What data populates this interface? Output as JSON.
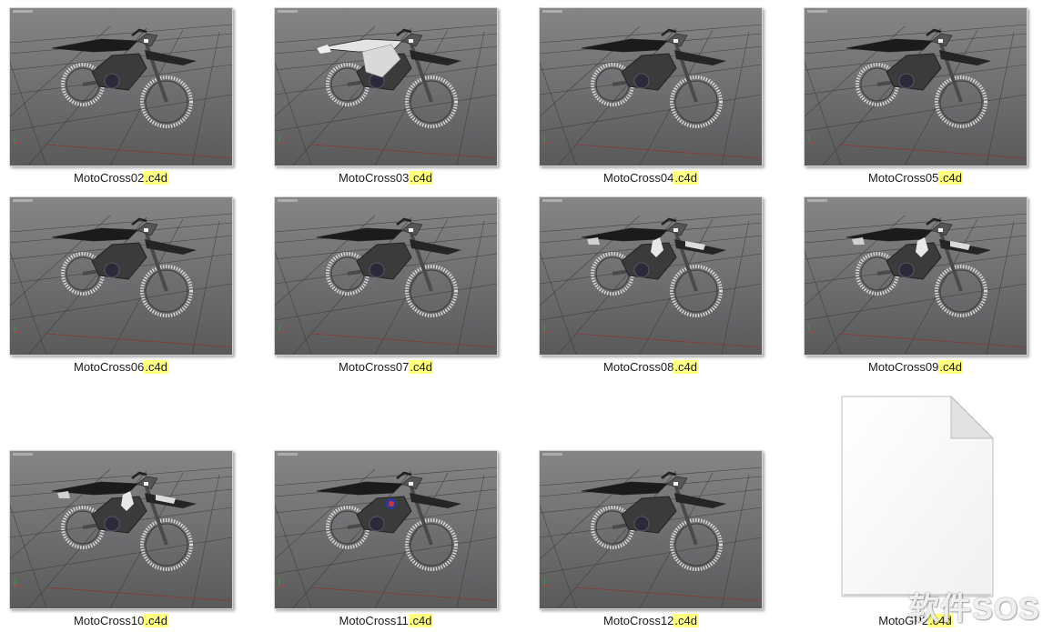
{
  "files": [
    {
      "stem": "MotoCross02",
      "ext": ".c4d",
      "thumb": "motocross-render",
      "variant": "dark"
    },
    {
      "stem": "MotoCross03",
      "ext": ".c4d",
      "thumb": "motocross-render",
      "variant": "white"
    },
    {
      "stem": "MotoCross04",
      "ext": ".c4d",
      "thumb": "motocross-render",
      "variant": "dark"
    },
    {
      "stem": "MotoCross05",
      "ext": ".c4d",
      "thumb": "motocross-render",
      "variant": "dark"
    },
    {
      "stem": "MotoCross06",
      "ext": ".c4d",
      "thumb": "motocross-render",
      "variant": "dark"
    },
    {
      "stem": "MotoCross07",
      "ext": ".c4d",
      "thumb": "motocross-render",
      "variant": "dark"
    },
    {
      "stem": "MotoCross08",
      "ext": ".c4d",
      "thumb": "motocross-render",
      "variant": "decal"
    },
    {
      "stem": "MotoCross09",
      "ext": ".c4d",
      "thumb": "motocross-render",
      "variant": "decal"
    },
    {
      "stem": "MotoCross10",
      "ext": ".c4d",
      "thumb": "motocross-render",
      "variant": "decal"
    },
    {
      "stem": "MotoCross11",
      "ext": ".c4d",
      "thumb": "motocross-render",
      "variant": "badge"
    },
    {
      "stem": "MotoCross12",
      "ext": ".c4d",
      "thumb": "motocross-render",
      "variant": "dark"
    },
    {
      "stem": "MotoGP2",
      "ext": ".c4d",
      "thumb": "generic-file-icon",
      "variant": "blank"
    }
  ],
  "colors": {
    "viewport_bg_top": "#858585",
    "viewport_bg_bottom": "#5a5a5a",
    "grid_line": "#3a3a3a",
    "extension_highlight": "#ffff80"
  },
  "watermark": "软件SOS"
}
